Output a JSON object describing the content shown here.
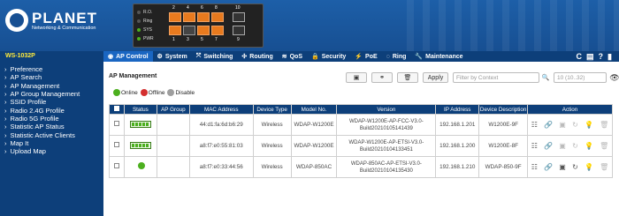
{
  "brand": {
    "name": "PLANET",
    "tagline": "Networking & Communication"
  },
  "device": {
    "led_labels": [
      "R.O.",
      "Ring",
      "SYS",
      "PWR"
    ],
    "top_ports": [
      "2",
      "4",
      "6",
      "8",
      "10"
    ],
    "bottom_ports": [
      "1",
      "3",
      "5",
      "7",
      "9"
    ]
  },
  "model": "WS-1032P",
  "menu": [
    {
      "label": "AP Control",
      "icon": "ap-control-icon",
      "glyph": "◉",
      "active": true
    },
    {
      "label": "System",
      "icon": "gear-icon",
      "glyph": "⚙",
      "active": false
    },
    {
      "label": "Switching",
      "icon": "switching-icon",
      "glyph": "⤧",
      "active": false
    },
    {
      "label": "Routing",
      "icon": "routing-icon",
      "glyph": "✣",
      "active": false
    },
    {
      "label": "QoS",
      "icon": "qos-icon",
      "glyph": "≋",
      "active": false
    },
    {
      "label": "Security",
      "icon": "lock-icon",
      "glyph": "🔒",
      "active": false
    },
    {
      "label": "PoE",
      "icon": "poe-icon",
      "glyph": "⚡",
      "active": false
    },
    {
      "label": "Ring",
      "icon": "ring-icon",
      "glyph": "◌",
      "active": false
    },
    {
      "label": "Maintenance",
      "icon": "wrench-icon",
      "glyph": "🔧",
      "active": false
    }
  ],
  "tools": [
    "C",
    "▤",
    "?",
    "▮"
  ],
  "sidebar": [
    "Preference",
    "AP Search",
    "AP Management",
    "AP Group Management",
    "SSID Profile",
    "Radio 2.4G Profile",
    "Radio 5G Profile",
    "Statistic AP Status",
    "Statistic Active Clients",
    "Map It",
    "Upload Map"
  ],
  "page_title": "AP Management",
  "legend": [
    {
      "label": "Online",
      "color": "#4caf1f"
    },
    {
      "label": "Offline",
      "color": "#d32f2f"
    },
    {
      "label": "Disable",
      "color": "#9e9e9e"
    }
  ],
  "toolbar": {
    "apply": "Apply",
    "filter_placeholder": "Filter by Context",
    "range": "10 (10..32)"
  },
  "table": {
    "headers": [
      "",
      "Status",
      "AP Group",
      "MAC Address",
      "Device Type",
      "Model No.",
      "Version",
      "IP Address",
      "Device Description",
      "Action"
    ],
    "rows": [
      {
        "status": "bar",
        "group": "",
        "mac": "44:d1:fa:6d:b6:29",
        "type": "Wireless",
        "model": "WDAP-W1200E",
        "version": "WDAP-W1200E-AP-FCC-V3.0-Build20210105141439",
        "ip": "192.168.1.201",
        "desc": "W1200E-9F"
      },
      {
        "status": "bar",
        "group": "",
        "mac": "a8:f7:e0:55:81:03",
        "type": "Wireless",
        "model": "WDAP-W1200E",
        "version": "WDAP-W1200E-AP-ETSI-V3.0-Build20210104133451",
        "ip": "192.168.1.200",
        "desc": "W1200E-8F"
      },
      {
        "status": "dot",
        "group": "",
        "mac": "a8:f7:e0:33:44:56",
        "type": "Wireless",
        "model": "WDAP-850AC",
        "version": "WDAP-850AC-AP-ETSI-V3.0-Build20210104135430",
        "ip": "192.168.1.210",
        "desc": "WDAP-850-9F"
      }
    ]
  },
  "colors": {
    "header": "#174f92",
    "nav": "#0d3f7a",
    "active_tab": "#1a66c2",
    "model_text": "#ffeb3b"
  }
}
